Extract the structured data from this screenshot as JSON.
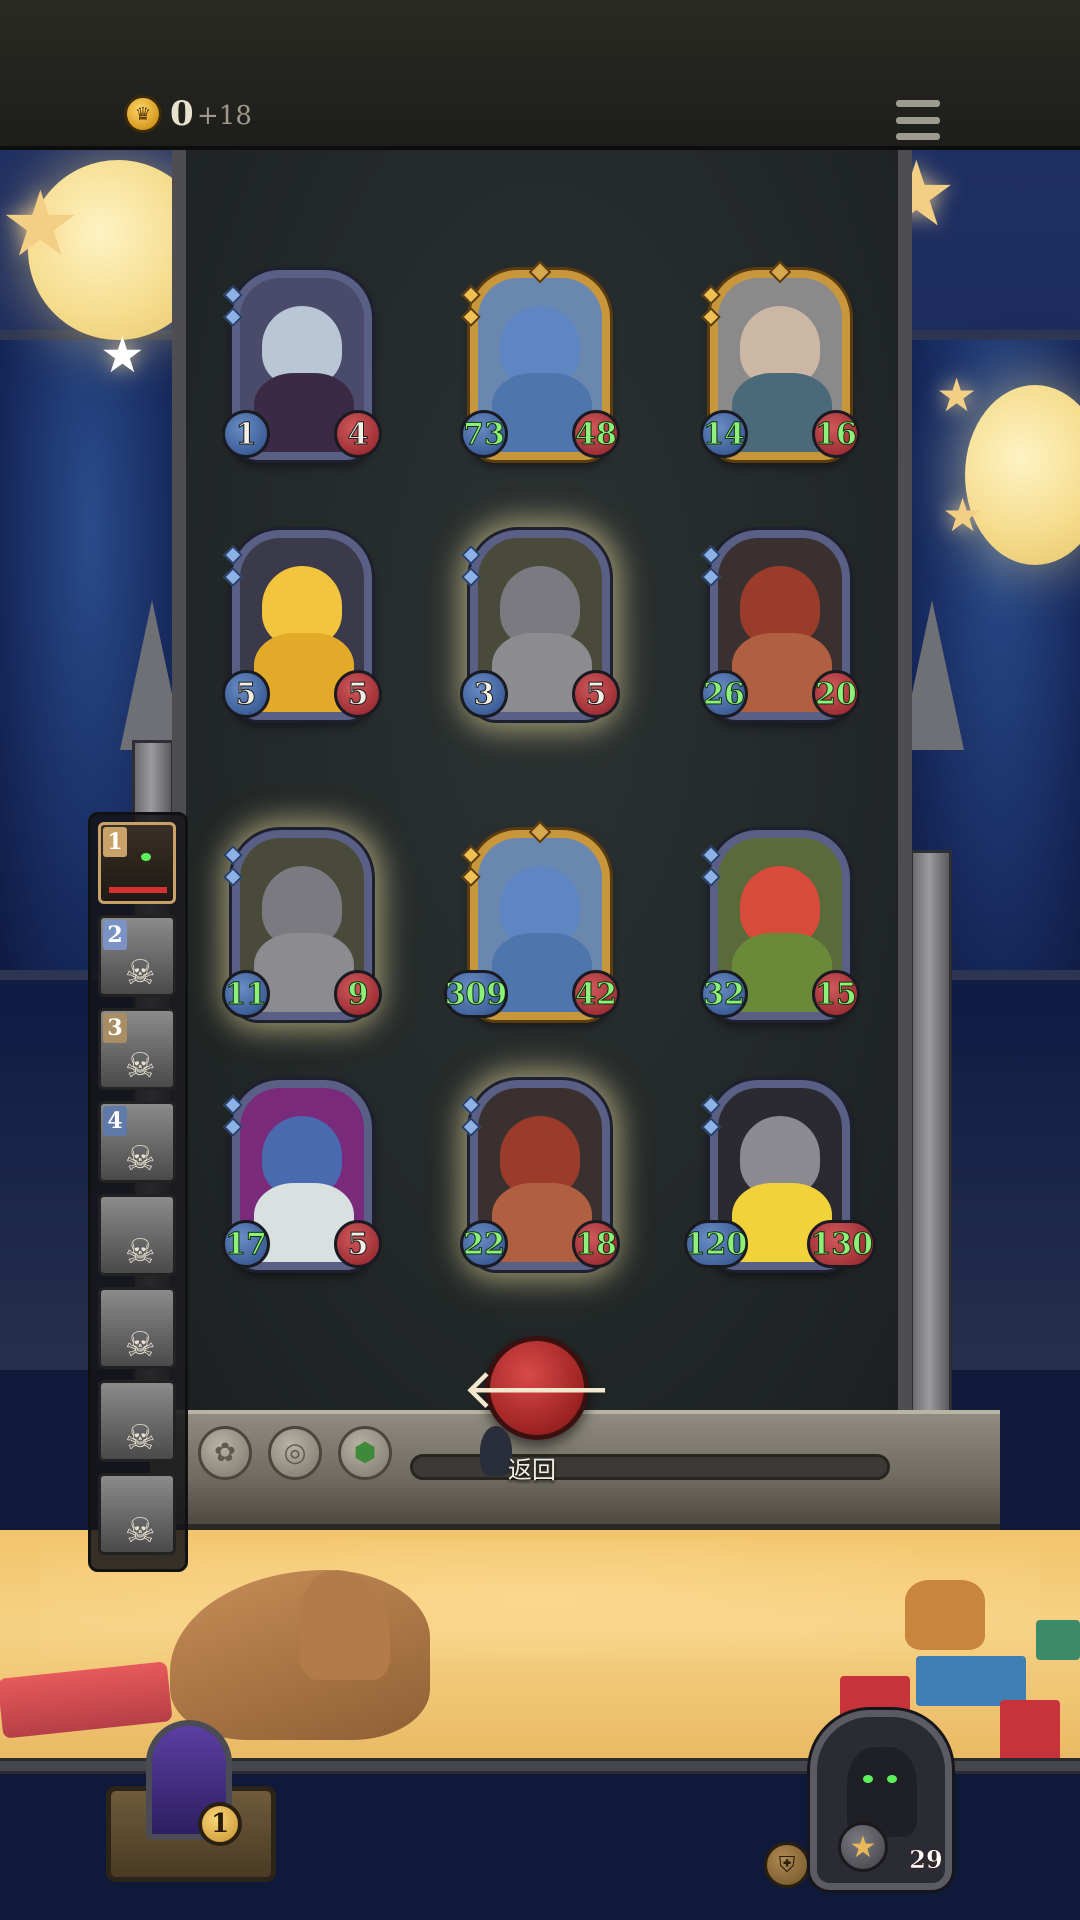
{
  "header": {
    "coins": "0",
    "coin_income": "+18",
    "coin_icon": "crown-coin-icon",
    "menu_icon": "hamburger-menu-icon"
  },
  "board": {
    "cards": [
      {
        "attack": "1",
        "health": "4",
        "attack_color": "white",
        "health_color": "white",
        "frame": "silver",
        "glow": false,
        "art": "blue-haired-elf-sorceress"
      },
      {
        "attack": "73",
        "health": "48",
        "attack_color": "green",
        "health_color": "green",
        "frame": "gold",
        "glow": false,
        "art": "blue-baby-dragon"
      },
      {
        "attack": "14",
        "health": "16",
        "attack_color": "green",
        "health_color": "green",
        "frame": "gold",
        "glow": false,
        "art": "horned-winged-demon"
      },
      {
        "attack": "5",
        "health": "5",
        "attack_color": "white",
        "health_color": "white",
        "frame": "silver",
        "glow": false,
        "art": "golden-dragon"
      },
      {
        "attack": "3",
        "health": "5",
        "attack_color": "white",
        "health_color": "white",
        "frame": "silver",
        "glow": true,
        "art": "grey-horned-dragon"
      },
      {
        "attack": "26",
        "health": "20",
        "attack_color": "green",
        "health_color": "green",
        "frame": "silver",
        "glow": false,
        "art": "red-serpent-dragon"
      },
      {
        "attack": "11",
        "health": "9",
        "attack_color": "green",
        "health_color": "green",
        "frame": "silver",
        "glow": true,
        "art": "grey-horned-dragon"
      },
      {
        "attack": "309",
        "health": "42",
        "attack_color": "green",
        "health_color": "green",
        "frame": "gold",
        "glow": false,
        "art": "blue-baby-dragon"
      },
      {
        "attack": "32",
        "health": "15",
        "attack_color": "green",
        "health_color": "green",
        "frame": "silver",
        "glow": false,
        "art": "red-grinning-imp"
      },
      {
        "attack": "17",
        "health": "5",
        "attack_color": "green",
        "health_color": "white",
        "frame": "silver",
        "glow": false,
        "art": "mushroom-hat-goblin"
      },
      {
        "attack": "22",
        "health": "18",
        "attack_color": "green",
        "health_color": "green",
        "frame": "silver",
        "glow": true,
        "art": "red-serpent-dragon"
      },
      {
        "attack": "120",
        "health": "130",
        "attack_color": "green",
        "health_color": "green",
        "frame": "silver",
        "glow": false,
        "art": "armored-knight-lightning"
      }
    ],
    "return_label": "返回",
    "return_icon": "arrow-left-icon",
    "slot_icons": [
      "flower-icon",
      "ring-icon",
      "hexagon-gem-icon"
    ]
  },
  "queue": {
    "items": [
      {
        "number": "1",
        "active": true,
        "num_color": "#c9a26a"
      },
      {
        "number": "2",
        "active": false,
        "num_color": "#7b92c4"
      },
      {
        "number": "3",
        "active": false,
        "num_color": "#a98d63"
      },
      {
        "number": "4",
        "active": false,
        "num_color": "#5f79a8"
      },
      {
        "number": "",
        "active": false,
        "num_color": ""
      },
      {
        "number": "",
        "active": false,
        "num_color": ""
      },
      {
        "number": "",
        "active": false,
        "num_color": ""
      },
      {
        "number": "",
        "active": false,
        "num_color": ""
      }
    ],
    "skull_icon": "skull-icon"
  },
  "hud": {
    "deck_count": "1",
    "hero_health": "29",
    "hero_star_icon": "star-icon",
    "hero_ability_icon": "shield-icon"
  },
  "colors": {
    "gold_frame": "#c9973b",
    "silver_frame": "#5a5f86",
    "return_button": "#b02c2a",
    "buff_text": "#8df07a"
  }
}
